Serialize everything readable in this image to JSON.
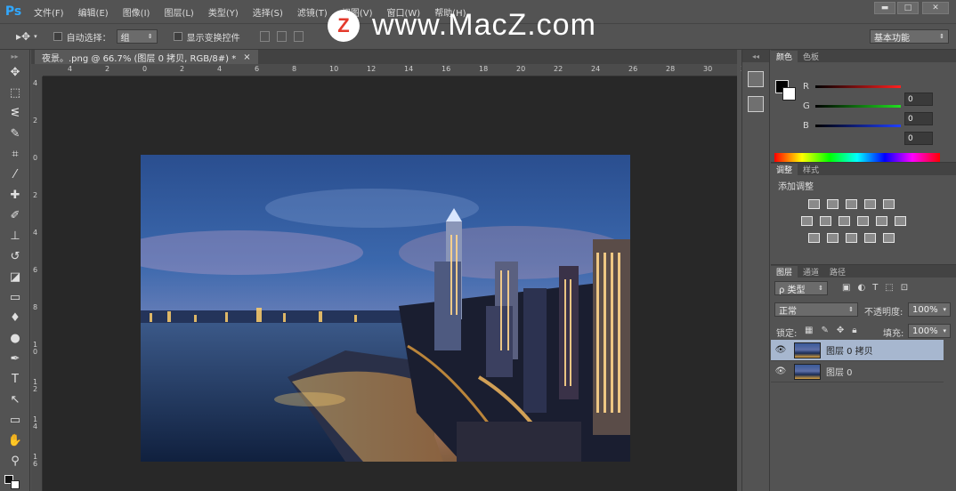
{
  "app": {
    "logo": "Ps"
  },
  "menu": [
    "文件(F)",
    "编辑(E)",
    "图像(I)",
    "图层(L)",
    "类型(Y)",
    "选择(S)",
    "滤镜(T)",
    "视图(V)",
    "窗口(W)",
    "帮助(H)"
  ],
  "window_controls": {
    "minimize": "▬",
    "restore": "□",
    "close": "✕"
  },
  "options": {
    "auto_select_label": "自动选择：",
    "auto_select_value": "组",
    "show_transform_label": "显示变换控件",
    "workspace": "基本功能"
  },
  "watermark": {
    "letter": "Z",
    "text": "www.MacZ.com"
  },
  "document": {
    "tab_title": "夜景。.png @ 66.7% (图层 0 拷贝, RGB/8#) *",
    "tab_close": "×"
  },
  "ruler": {
    "h_labels": [
      "4",
      "2",
      "0",
      "2",
      "4",
      "6",
      "8",
      "10",
      "12",
      "14",
      "16",
      "18",
      "20",
      "22",
      "24",
      "26",
      "28",
      "30",
      "3"
    ],
    "v_labels": [
      "4",
      "2",
      "0",
      "2",
      "4",
      "6",
      "8",
      "1\n0",
      "1\n2",
      "1\n4",
      "1\n6"
    ]
  },
  "color_panel": {
    "tabs": [
      "颜色",
      "色板"
    ],
    "channels": [
      {
        "label": "R",
        "value": "0",
        "gradient": "#ff2020"
      },
      {
        "label": "G",
        "value": "0",
        "gradient": "#20e020"
      },
      {
        "label": "B",
        "value": "0",
        "gradient": "#2040ff"
      }
    ]
  },
  "adjust_panel": {
    "tabs": [
      "调整",
      "样式"
    ],
    "title": "添加调整"
  },
  "layers_panel": {
    "tabs": [
      "图层",
      "通道",
      "路径"
    ],
    "filter": "ρ 类型",
    "blend_mode": "正常",
    "opacity_label": "不透明度:",
    "opacity_value": "100%",
    "lock_label": "锁定:",
    "fill_label": "填充:",
    "fill_value": "100%",
    "layers": [
      {
        "name": "图层 0 拷贝",
        "selected": true
      },
      {
        "name": "图层 0",
        "selected": false
      }
    ]
  },
  "icons": [
    "move-tool-icon",
    "marquee-tool-icon",
    "lasso-tool-icon",
    "quick-select-icon",
    "crop-tool-icon",
    "eyedropper-icon",
    "healing-brush-icon",
    "brush-tool-icon",
    "clone-stamp-icon",
    "history-brush-icon",
    "eraser-icon",
    "gradient-icon",
    "blur-icon",
    "dodge-icon",
    "pen-tool-icon",
    "type-tool-icon",
    "path-select-icon",
    "rectangle-tool-icon",
    "hand-tool-icon",
    "zoom-tool-icon"
  ]
}
